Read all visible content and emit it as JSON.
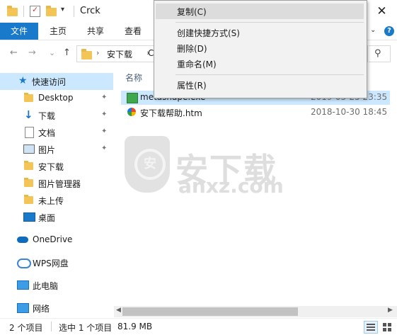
{
  "window": {
    "title": "Crck",
    "close_glyph": "✕"
  },
  "ribbon": {
    "file_tab": "文件",
    "tabs": [
      "主页",
      "共享",
      "查看"
    ],
    "help_glyph": "?"
  },
  "address": {
    "path": "安下载",
    "path_extra": "C",
    "nav": {
      "back": "←",
      "forward": "→",
      "down": "⌄",
      "up": "↑"
    },
    "search_glyph": "⚲"
  },
  "nav_pane": {
    "quick_access": "快速访问",
    "pinned": [
      {
        "label": "Desktop",
        "icon": "folder-icon"
      },
      {
        "label": "下载",
        "icon": "download-icon"
      },
      {
        "label": "文档",
        "icon": "document-icon"
      },
      {
        "label": "图片",
        "icon": "picture-icon"
      }
    ],
    "folders": [
      "安下载",
      "图片管理器",
      "未上传"
    ],
    "desktop": "桌面",
    "onedrive": "OneDrive",
    "wps": "WPS网盘",
    "this_pc": "此电脑",
    "network": "网络",
    "pin_glyph": "📌"
  },
  "content": {
    "column_name": "名称",
    "files": [
      {
        "name": "metashape.exe",
        "date": "2019-03-25 23:35",
        "icon": "exe-icon"
      },
      {
        "name": "安下载帮助.htm",
        "date": "2018-10-30 18:45",
        "icon": "htm-icon"
      }
    ]
  },
  "watermark": {
    "shield_char": "安",
    "text": "安下载",
    "url": "anxz.com"
  },
  "context_menu": {
    "items": [
      {
        "label": "复制(C)"
      },
      {
        "label": "创建快捷方式(S)"
      },
      {
        "label": "删除(D)"
      },
      {
        "label": "重命名(M)"
      },
      {
        "label": "属性(R)"
      }
    ]
  },
  "status": {
    "item_count": "2 个项目",
    "selected": "选中 1 个项目",
    "size": "81.9 MB"
  },
  "colors": {
    "accent": "#1979ca",
    "selection": "#cce8ff",
    "menu_bg": "#f2f2f2",
    "menu_highlight": "#dcdcdc"
  }
}
